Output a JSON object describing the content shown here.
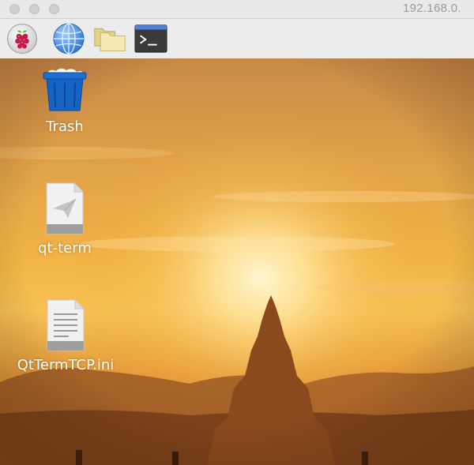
{
  "window": {
    "title": "192.168.0."
  },
  "taskbar": {
    "items": [
      {
        "name": "raspberry-pi-menu",
        "icon": "raspberry-icon"
      },
      {
        "name": "web-browser",
        "icon": "globe-icon"
      },
      {
        "name": "file-manager",
        "icon": "folder-icon"
      },
      {
        "name": "terminal",
        "icon": "terminal-icon"
      }
    ]
  },
  "desktop": {
    "icons": [
      {
        "label": "Trash",
        "icon": "trash-icon"
      },
      {
        "label": "qt-term",
        "icon": "executable-file-icon"
      },
      {
        "label": "QtTermTCP.ini",
        "icon": "text-file-icon"
      }
    ]
  },
  "colors": {
    "taskbar_bg": "#ececec",
    "trash_blue": "#1565c0",
    "terminal_dark": "#3a3a3a",
    "folder_yellow": "#f5e6a8",
    "wallpaper_sky": "#f0a030"
  }
}
